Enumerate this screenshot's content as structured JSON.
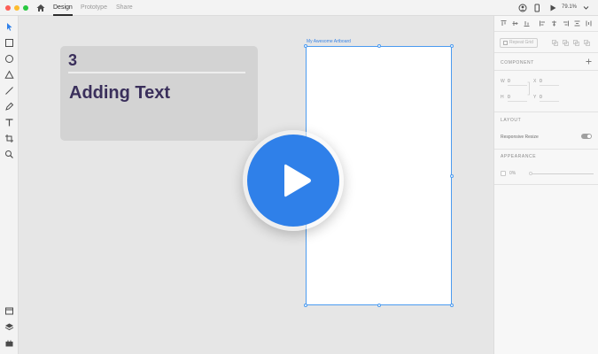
{
  "titlebar": {
    "tabs": [
      {
        "label": "Design",
        "active": true
      },
      {
        "label": "Prototype",
        "active": false
      },
      {
        "label": "Share",
        "active": false
      }
    ],
    "zoom": "79.1%"
  },
  "toolbar": {
    "tools": [
      "select-tool",
      "rectangle-tool",
      "ellipse-tool",
      "polygon-tool",
      "line-tool",
      "pen-tool",
      "text-tool",
      "artboard-tool",
      "zoom-tool"
    ],
    "bottom": [
      "assets-icon",
      "layers-icon",
      "plugins-icon"
    ]
  },
  "canvas": {
    "card": {
      "number": "3",
      "title": "Adding Text"
    },
    "artboard": {
      "name": "My Awesome Artboard"
    },
    "play_button": {
      "label": "play-icon"
    }
  },
  "panel": {
    "repeat_grid": "Repeat Grid",
    "component_label": "COMPONENT",
    "fields": {
      "w_label": "W",
      "w_value": "0",
      "x_label": "X",
      "x_value": "0",
      "h_label": "H",
      "h_value": "0",
      "y_label": "Y",
      "y_value": "0"
    },
    "layout_label": "LAYOUT",
    "responsive_resize": "Responsive Resize",
    "responsive_resize_on": true,
    "appearance_label": "APPEARANCE",
    "opacity": "0%"
  },
  "colors": {
    "accent": "#2f80e9",
    "card_text": "#3a2f5b",
    "artboard_border": "#4b9bf0"
  }
}
